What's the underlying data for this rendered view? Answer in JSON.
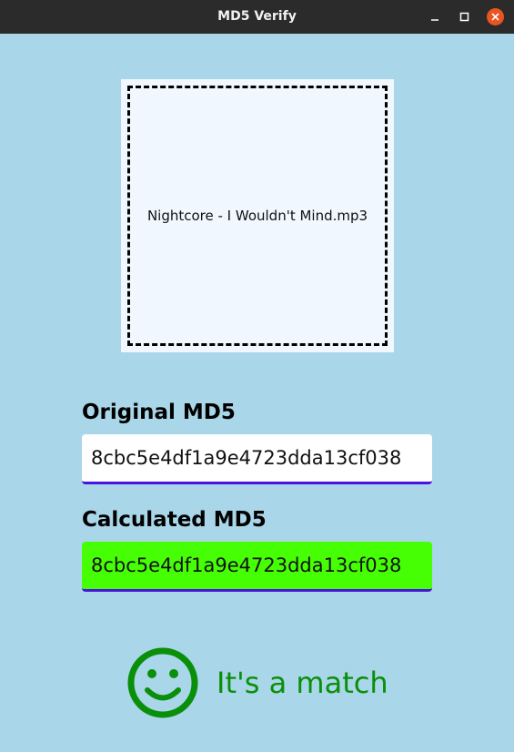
{
  "window": {
    "title": "MD5 Verify",
    "controls": {
      "minimize_icon": "minimize-icon",
      "maximize_icon": "maximize-icon",
      "close_icon": "close-icon"
    }
  },
  "dropzone": {
    "filename": "Nightcore - I Wouldn't Mind.mp3"
  },
  "original": {
    "label": "Original MD5",
    "value": "8cbc5e4df1a9e4723dda13cf038"
  },
  "calculated": {
    "label": "Calculated MD5",
    "value": "8cbc5e4df1a9e4723dda13cf038"
  },
  "result": {
    "icon": "smiley-icon",
    "text": "It's a match"
  },
  "colors": {
    "background": "#a9d6e8",
    "titlebar": "#2b2b2b",
    "close_button": "#e95420",
    "match_field": "#46ff05",
    "field_underline": "#4a14e0",
    "match_green": "#0a8f0a"
  }
}
